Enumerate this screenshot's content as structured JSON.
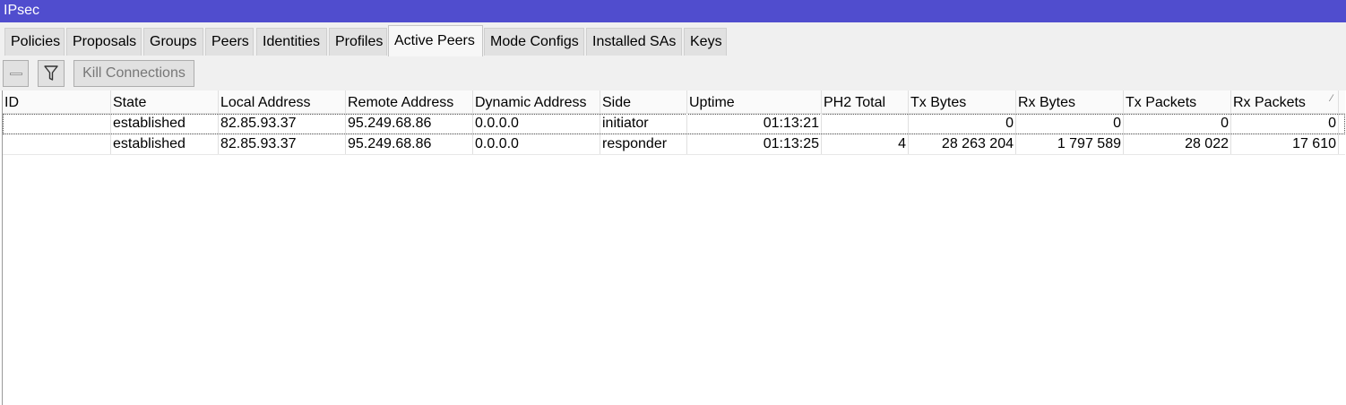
{
  "window": {
    "title": "IPsec"
  },
  "tabs": [
    {
      "label": "Policies"
    },
    {
      "label": "Proposals"
    },
    {
      "label": "Groups"
    },
    {
      "label": "Peers"
    },
    {
      "label": "Identities"
    },
    {
      "label": "Profiles"
    },
    {
      "label": "Active Peers",
      "active": true
    },
    {
      "label": "Mode Configs"
    },
    {
      "label": "Installed SAs"
    },
    {
      "label": "Keys"
    }
  ],
  "toolbar": {
    "remove_icon": "minus-icon",
    "filter_icon": "filter-icon",
    "kill_label": "Kill Connections"
  },
  "table": {
    "columns": [
      "ID",
      "State",
      "Local Address",
      "Remote Address",
      "Dynamic Address",
      "Side",
      "Uptime",
      "PH2 Total",
      "Tx Bytes",
      "Rx Bytes",
      "Tx Packets",
      "Rx Packets"
    ],
    "sort_column": "Rx Packets",
    "rows": [
      {
        "id": "",
        "state": "established",
        "local": "82.85.93.37",
        "remote": "95.249.68.86",
        "dynamic": "0.0.0.0",
        "side": "initiator",
        "uptime": "01:13:21",
        "ph2": "",
        "tx_bytes": "0",
        "rx_bytes": "0",
        "tx_packets": "0",
        "rx_packets": "0"
      },
      {
        "id": "",
        "state": "established",
        "local": "82.85.93.37",
        "remote": "95.249.68.86",
        "dynamic": "0.0.0.0",
        "side": "responder",
        "uptime": "01:13:25",
        "ph2": "4",
        "tx_bytes": "28 263 204",
        "rx_bytes": "1 797 589",
        "tx_packets": "28 022",
        "rx_packets": "17 610"
      }
    ]
  },
  "colors": {
    "titlebar": "#504dce",
    "tab_bg": "#e1e1e1",
    "tab_active_bg": "#f7f7f7"
  }
}
